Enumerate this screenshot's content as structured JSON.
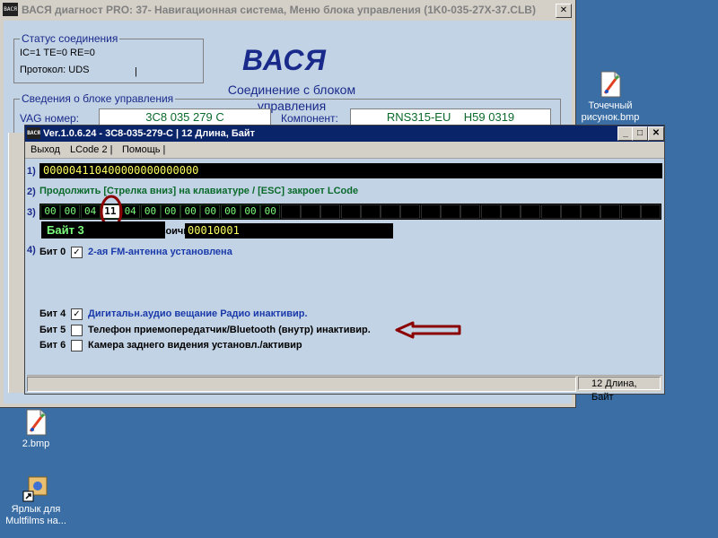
{
  "desktop": {
    "icons": [
      {
        "label": "Точечный рисунок.bmp"
      },
      {
        "label": "2.bmp"
      },
      {
        "label": "Ярлык для Multfilms на..."
      }
    ]
  },
  "main_window": {
    "app_icon_text": "ВАСЯ",
    "title": "ВАСЯ диагност PRO: 37- Навигационная система, Меню блока управления (1K0-035-27X-37.CLB)",
    "close_glyph": "✕",
    "status_group": {
      "title": "Статус соединения",
      "line1": "IC=1  TE=0  RE=0",
      "line2": "Протокол: UDS",
      "cursor": "|"
    },
    "logo": "ВАСЯ",
    "connection_text": "Соединение с блоком управления",
    "ecu_group": {
      "title": "Сведения о блоке управления",
      "vag_label": "VAG номер:",
      "vag_value": "3C8 035 279 C",
      "component_label": "Компонент:",
      "component_value": "RNS315-EU    H59 0319"
    }
  },
  "lcode_window": {
    "app_icon_text": "ВАСЯ",
    "title": "Ver.1.0.6.24 -   3C8-035-279-C | 12 Длина, Байт",
    "buttons": {
      "minimize": "_",
      "maximize": "□",
      "close": "✕"
    },
    "menu": [
      {
        "label": "Выход"
      },
      {
        "label": "LCode 2 |"
      },
      {
        "label": "Помощь |"
      }
    ],
    "row1_num": "1)",
    "coding_string": "000004110400000000000000",
    "row2_num": "2)",
    "hint": "Продолжить [Стрелка вниз] на клавиатуре / [ESC] закроет LCode",
    "row3_num": "3)",
    "bytes": [
      "00",
      "00",
      "04",
      "11",
      "04",
      "00",
      "00",
      "00",
      "00",
      "00",
      "00",
      "00"
    ],
    "selected_byte_index": 3,
    "empty_cells": 19,
    "byte_label": "Байт 3",
    "binary_label": "Двоичный:",
    "binary_value": "00010001",
    "row4_num": "4)",
    "bits": [
      {
        "label": "Бит 0",
        "checked": true,
        "desc": "2-ая FM-антенна установлена",
        "color": "#1a3aaa"
      },
      {
        "label": "Бит 4",
        "checked": true,
        "desc": "Дигитальн.аудио вещание Радио инактивир.",
        "color": "#1a3aaa"
      },
      {
        "label": "Бит 5",
        "checked": false,
        "desc": "Телефон приемопередатчик/Bluetooth (внутр) инактивир.",
        "color": "#000000"
      },
      {
        "label": "Бит 6",
        "checked": false,
        "desc": "Камера заднего видения установл./активир",
        "color": "#000000"
      }
    ],
    "check_glyph": "✓",
    "status_right": "12 Длина, Байт"
  },
  "colors": {
    "annotation": "#8b0000",
    "desktop": "#3a6ea5",
    "titlebar_active": "#0a246a"
  }
}
